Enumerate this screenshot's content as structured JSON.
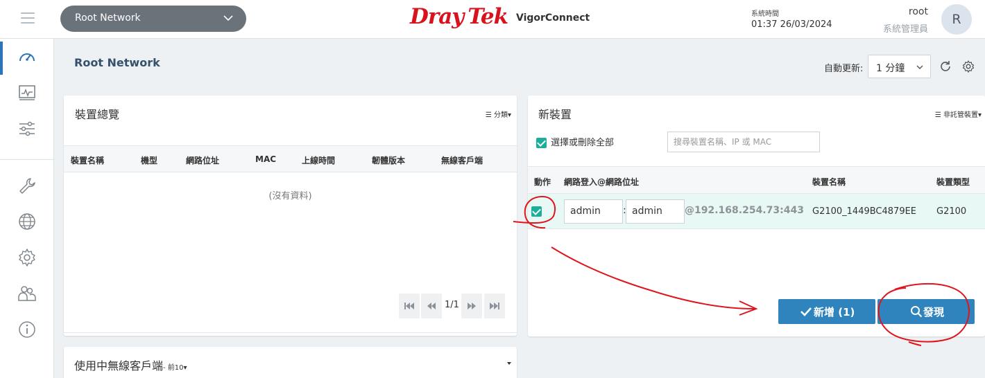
{
  "header": {
    "network_select": "Root Network",
    "logo_part1": "Dray",
    "logo_part2": "Tek",
    "app_name": "VigorConnect",
    "system_time_label": "系統時間",
    "system_time_value": "01:37 26/03/2024",
    "user_name": "root",
    "user_role": "系統管理員",
    "avatar_letter": "R"
  },
  "sidebar": {
    "items": [
      {
        "icon": "dashboard-gauge-icon",
        "active": true
      },
      {
        "icon": "monitor-chart-icon",
        "active": false
      },
      {
        "icon": "sliders-icon",
        "active": false
      },
      {
        "icon": "wrench-icon",
        "active": false
      },
      {
        "icon": "globe-icon",
        "active": false
      },
      {
        "icon": "gear-icon",
        "active": false
      },
      {
        "icon": "users-icon",
        "active": false
      },
      {
        "icon": "info-icon",
        "active": false
      }
    ]
  },
  "page": {
    "title": "Root Network",
    "auto_refresh_label": "自動更新:",
    "auto_refresh_value": "1 分鐘"
  },
  "overview": {
    "title": "裝置總覽",
    "menu_label": "☰ 分類▾",
    "columns": [
      "裝置名稱",
      "機型",
      "網路位址",
      "MAC",
      "上線時間",
      "韌體版本",
      "無線客戶端"
    ],
    "no_data": "(沒有資料)",
    "page_indicator": "1/1"
  },
  "new_devices": {
    "title": "新裝置",
    "menu_label": "☰ 非託管裝置▾",
    "select_all_label": "選擇或刪除全部",
    "search_placeholder": "搜尋裝置名稱、IP 或 MAC",
    "columns": [
      "動作",
      "網路登入@網路位址",
      "裝置名稱",
      "裝置類型"
    ],
    "rows": [
      {
        "checked": true,
        "username": "admin",
        "password": "admin",
        "address": "@192.168.254.73:443",
        "device_name": "G2100_1449BC4879EE",
        "device_type": "G2100"
      }
    ],
    "add_button": "新增 (1)",
    "discover_button": "發現"
  },
  "wireless": {
    "title": "使用中無線客戶端",
    "subtitle": "- 前10▾"
  },
  "colors": {
    "brand_red": "#d7141e",
    "accent_blue": "#2f84bd",
    "check_teal": "#1aaf9a",
    "annotation_red": "#e0141c"
  }
}
